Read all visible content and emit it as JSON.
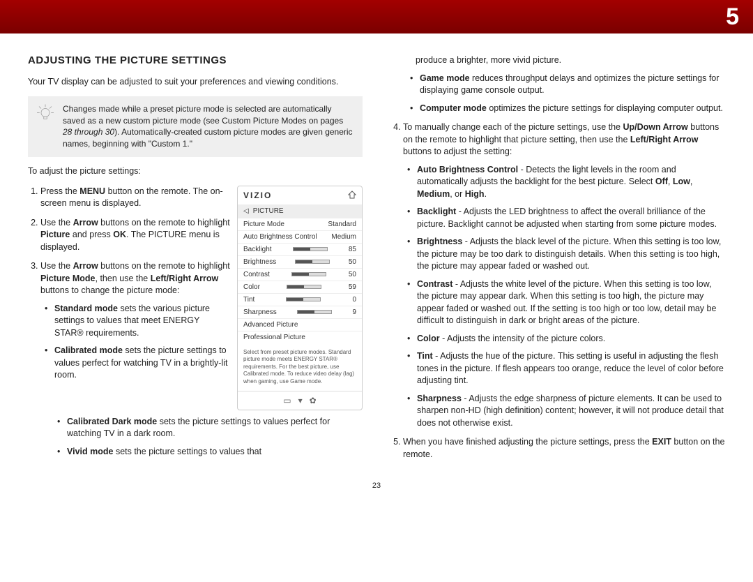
{
  "header": {
    "chapter_number": "5"
  },
  "page_number": "23",
  "left": {
    "title": "ADJUSTING THE PICTURE SETTINGS",
    "intro": "Your TV display can be adjusted to suit your preferences and viewing conditions.",
    "tip_prefix": "Changes made while a preset picture mode is selected are automatically saved as a new custom picture mode (see Custom Picture Modes on pages ",
    "tip_italic": "28 through 30",
    "tip_suffix": "). Automatically-created custom picture modes are given generic names, beginning with \"Custom 1.\"",
    "adjust_lead": "To adjust the picture settings:",
    "step1_a": "Press the ",
    "step1_b": "MENU",
    "step1_c": " button on the remote. The on-screen menu is displayed.",
    "step2_a": "Use the ",
    "step2_b": "Arrow",
    "step2_c": " buttons on the remote to highlight ",
    "step2_d": "Picture",
    "step2_e": " and press ",
    "step2_f": "OK",
    "step2_g": ". The PICTURE menu is displayed.",
    "step3_a": "Use the ",
    "step3_b": "Arrow",
    "step3_c": " buttons on the remote to highlight ",
    "step3_d": "Picture Mode",
    "step3_e": ", then use the ",
    "step3_f": "Left/Right Arrow",
    "step3_g": " buttons to change the picture mode:",
    "m_std_a": "Standard mode",
    "m_std_b": " sets the various picture settings to values that meet ENERGY STAR® requirements.",
    "m_cal_a": "Calibrated mode",
    "m_cal_b": " sets the picture settings to values perfect for watching TV in a brightly-lit room.",
    "m_cald_a": "Calibrated Dark mode",
    "m_cald_b": " sets the picture settings to values perfect for watching TV in a dark room.",
    "m_viv_a": "Vivid mode",
    "m_viv_b": " sets the picture settings to values that"
  },
  "panel": {
    "brand": "VIZIO",
    "section": "PICTURE",
    "rows": {
      "picture_mode": {
        "label": "Picture Mode",
        "value": "Standard"
      },
      "abc": {
        "label": "Auto Brightness Control",
        "value": "Medium"
      },
      "backlight": {
        "label": "Backlight",
        "value": "85"
      },
      "brightness": {
        "label": "Brightness",
        "value": "50"
      },
      "contrast": {
        "label": "Contrast",
        "value": "50"
      },
      "color": {
        "label": "Color",
        "value": "59"
      },
      "tint": {
        "label": "Tint",
        "value": "0"
      },
      "sharpness": {
        "label": "Sharpness",
        "value": "9"
      },
      "advanced": {
        "label": "Advanced Picture"
      },
      "professional": {
        "label": "Professional Picture"
      }
    },
    "hint": "Select from preset picture modes. Standard picture mode meets ENERGY STAR® requirements. For the best picture, use Calibrated mode. To reduce video delay (lag) when gaming, use Game mode."
  },
  "right": {
    "cont_vivid": "produce a brighter, more vivid picture.",
    "m_game_a": "Game mode",
    "m_game_b": " reduces throughput delays and optimizes the picture settings for displaying game console output.",
    "m_comp_a": "Computer mode",
    "m_comp_b": " optimizes the picture settings for displaying computer output.",
    "step4_a": "To manually change each of the picture settings, use the ",
    "step4_b": "Up/Down Arrow",
    "step4_c": " buttons on the remote to highlight that picture setting, then use the ",
    "step4_d": "Left/Right Arrow",
    "step4_e": " buttons to adjust the setting:",
    "s_abc_a": "Auto Brightness Control",
    "s_abc_b": " - Detects the light levels in the room and automatically adjusts the backlight for the best picture. Select ",
    "s_abc_off": "Off",
    "s_abc_low": "Low",
    "s_abc_med": "Medium",
    "s_abc_high": "High",
    "comma": ", ",
    "or": ", or ",
    "period": ".",
    "s_back_a": "Backlight",
    "s_back_b": " - Adjusts the LED brightness to affect the overall brilliance of the picture. Backlight cannot be adjusted when starting from some picture modes.",
    "s_brt_a": "Brightness",
    "s_brt_b": " - Adjusts the black level of the picture. When this setting is too low, the picture may be too dark to distinguish details. When this setting is too high, the picture may appear faded or washed out.",
    "s_con_a": "Contrast",
    "s_con_b": " - Adjusts the white level of the picture. When this setting is too low, the picture may appear dark. When this setting is too high, the picture may appear faded or washed out. If the setting is too high or too low, detail may be difficult to distinguish in dark or bright areas of the picture.",
    "s_col_a": "Color",
    "s_col_b": " - Adjusts the intensity of the picture colors.",
    "s_tint_a": "Tint",
    "s_tint_b": " - Adjusts the hue of the picture. This setting is useful in adjusting the flesh tones in the picture. If flesh appears too orange, reduce the level of color before adjusting tint.",
    "s_shp_a": "Sharpness",
    "s_shp_b": " - Adjusts the edge sharpness of picture elements. It can be used to sharpen non-HD (high definition) content; however, it will not produce detail that does not otherwise exist.",
    "step5_a": "When you have finished adjusting the picture settings, press the ",
    "step5_b": "EXIT",
    "step5_c": " button on the remote."
  }
}
